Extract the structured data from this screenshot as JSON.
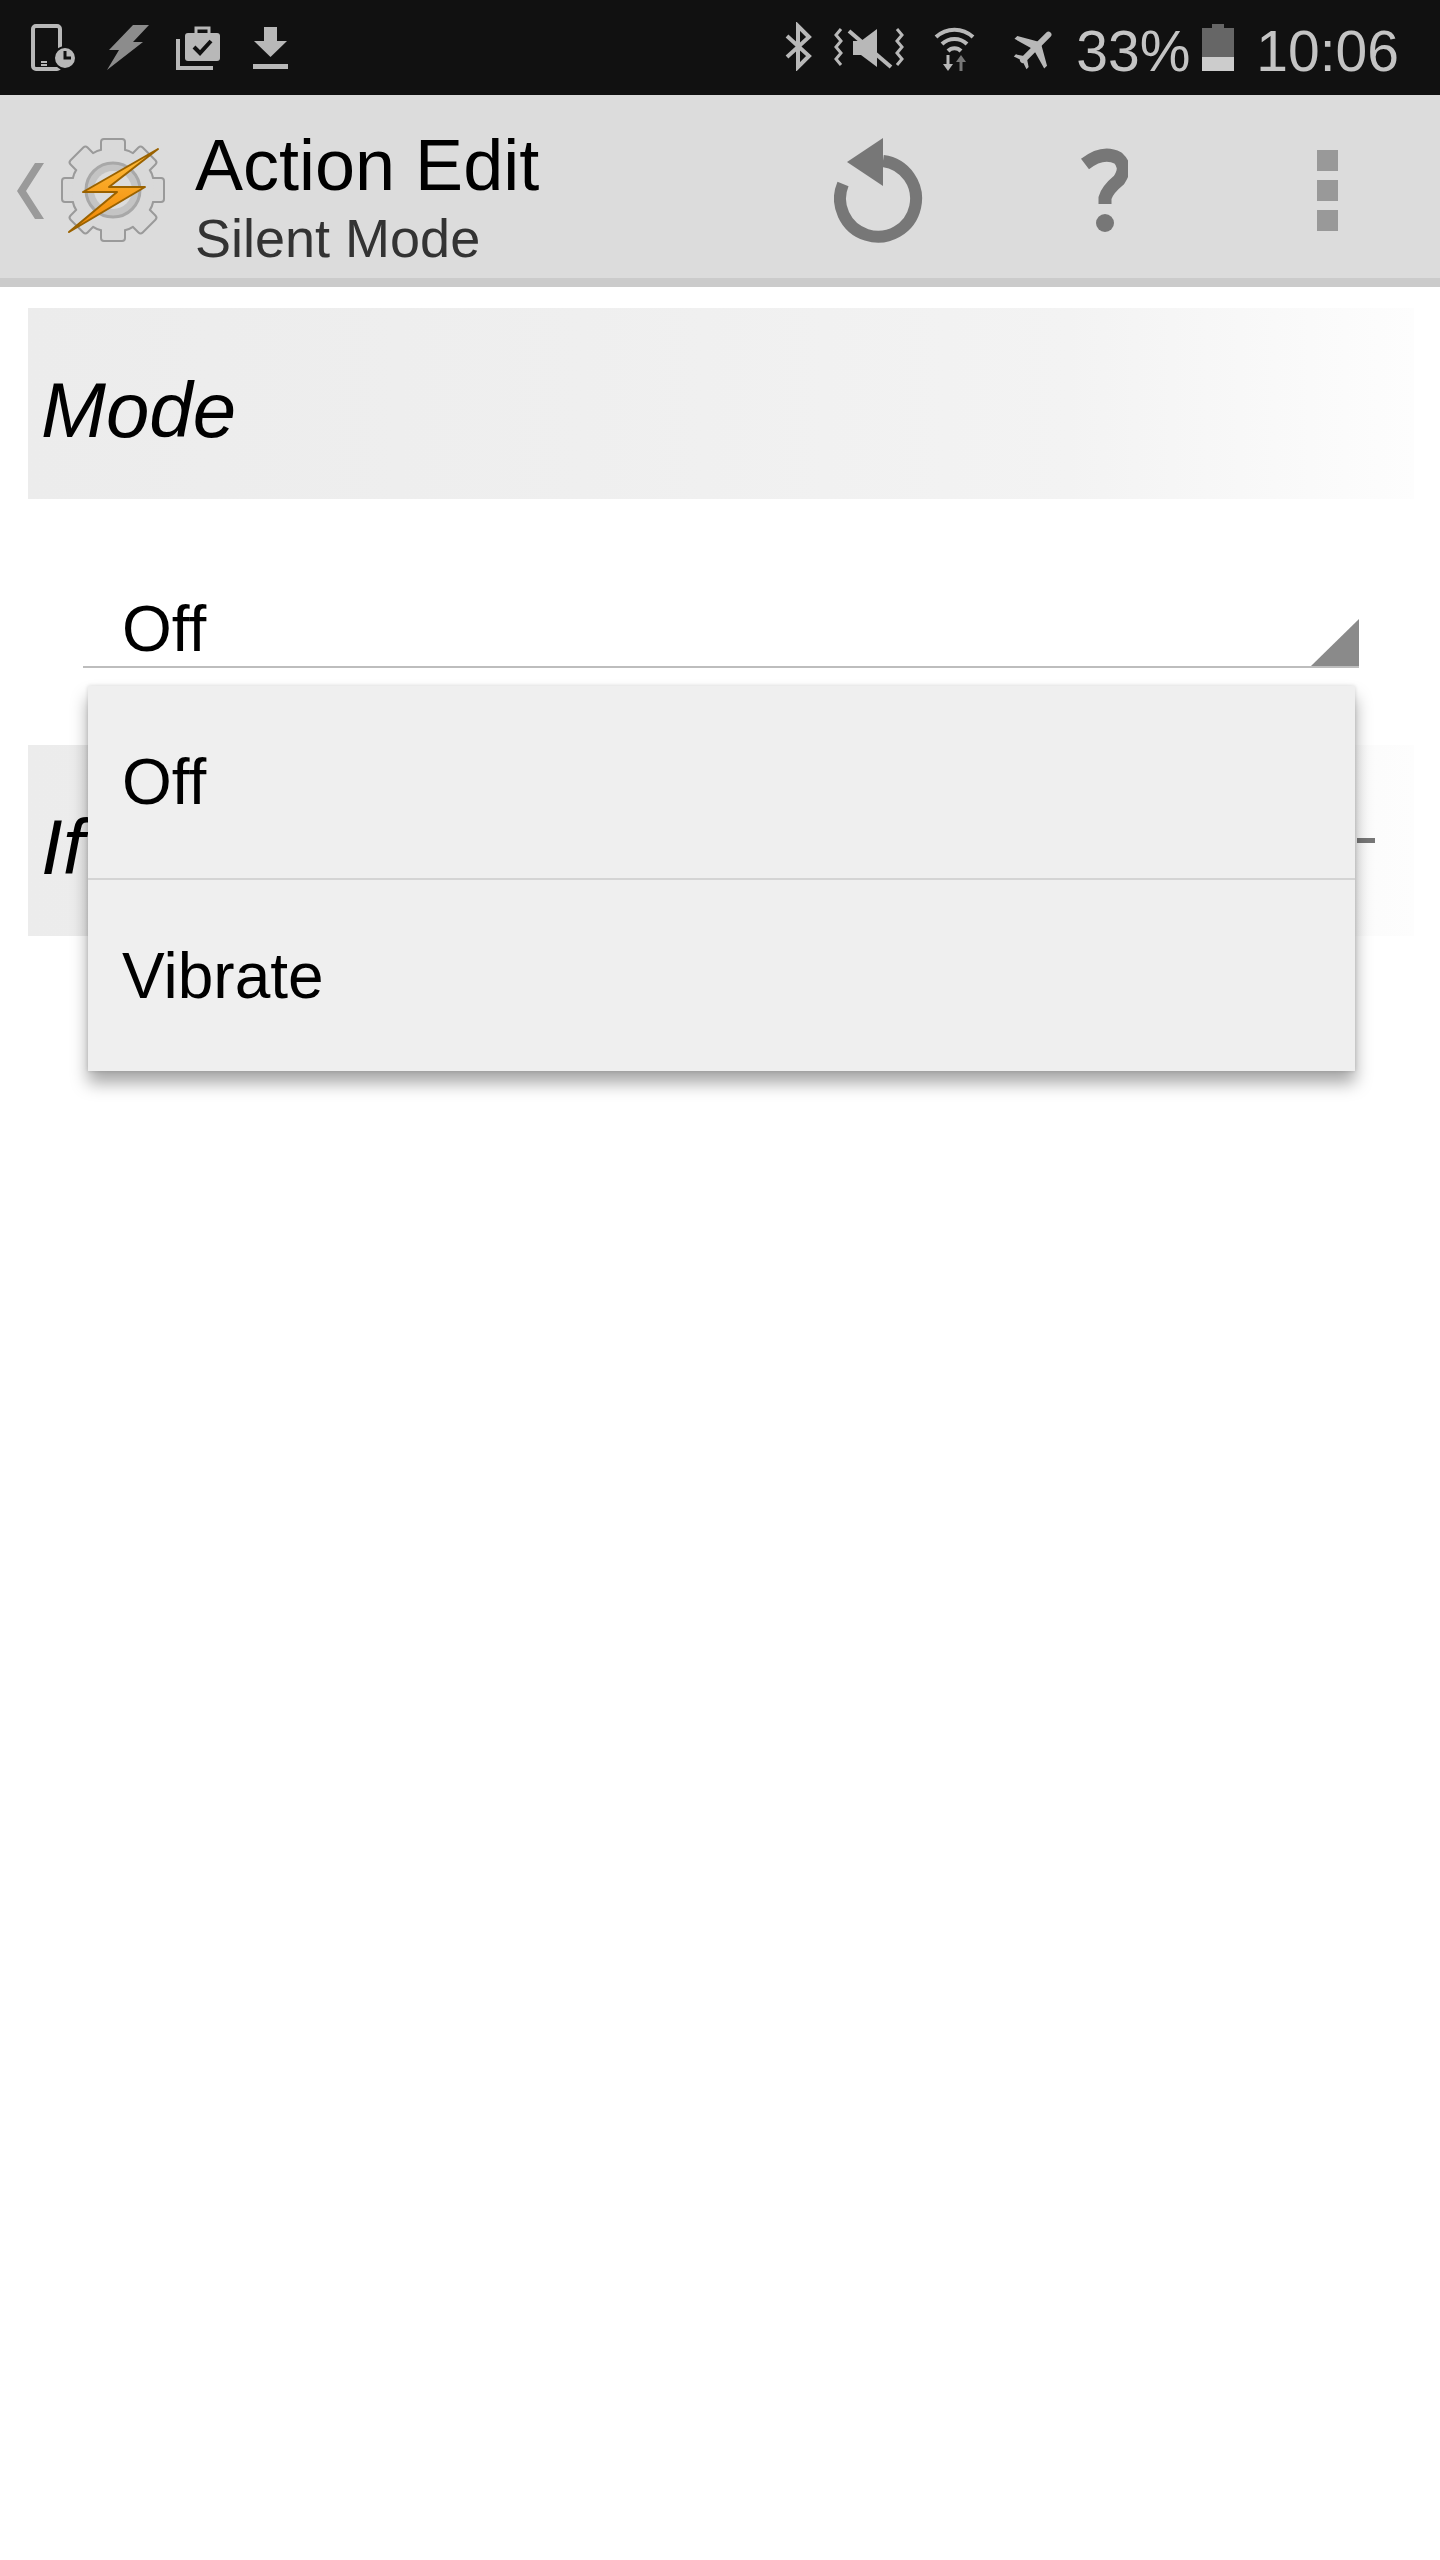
{
  "status_bar": {
    "battery_percent": "33%",
    "time": "10:06"
  },
  "action_bar": {
    "title": "Action Edit",
    "subtitle": "Silent Mode"
  },
  "mode_section": {
    "title": "Mode",
    "dropdown": {
      "value": "Off",
      "expanded": true,
      "options": [
        "Off",
        "Vibrate"
      ]
    }
  },
  "if_section": {
    "title": "If"
  }
}
